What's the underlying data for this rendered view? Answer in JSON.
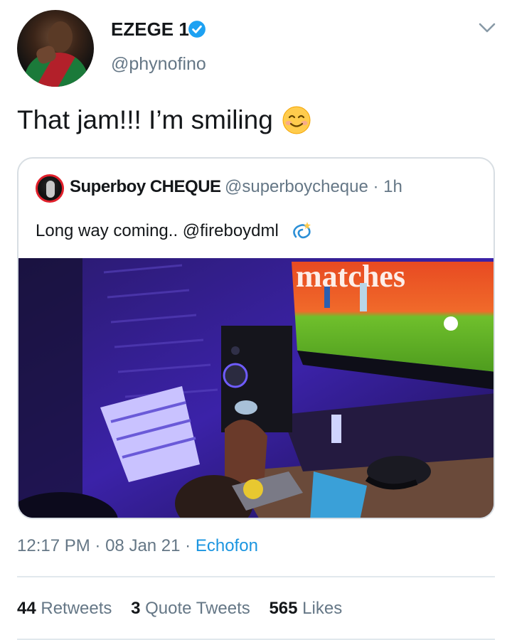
{
  "author": {
    "display_name": "EZEGE 1",
    "handle": "@phynofino",
    "verified": true
  },
  "tweet": {
    "text": "That jam!!! I’m smiling",
    "emoji": "smiling-face-icon"
  },
  "quoted_tweet": {
    "display_name": "Superboy CHEQUE",
    "handle_time": "@superboycheque · 1h",
    "text": "Long way coming.. @fireboydml",
    "emoji": "dizzy-icon",
    "screen_caption": "matches"
  },
  "meta": {
    "time": "12:17 PM",
    "date": "08 Jan 21",
    "source": "Echofon"
  },
  "stats": {
    "retweets_count": "44",
    "retweets_label": "Retweets",
    "quotes_count": "3",
    "quotes_label": "Quote Tweets",
    "likes_count": "565",
    "likes_label": "Likes"
  },
  "colors": {
    "accent": "#1b95e0",
    "secondary_text": "#657786",
    "border": "#d8dee3"
  }
}
